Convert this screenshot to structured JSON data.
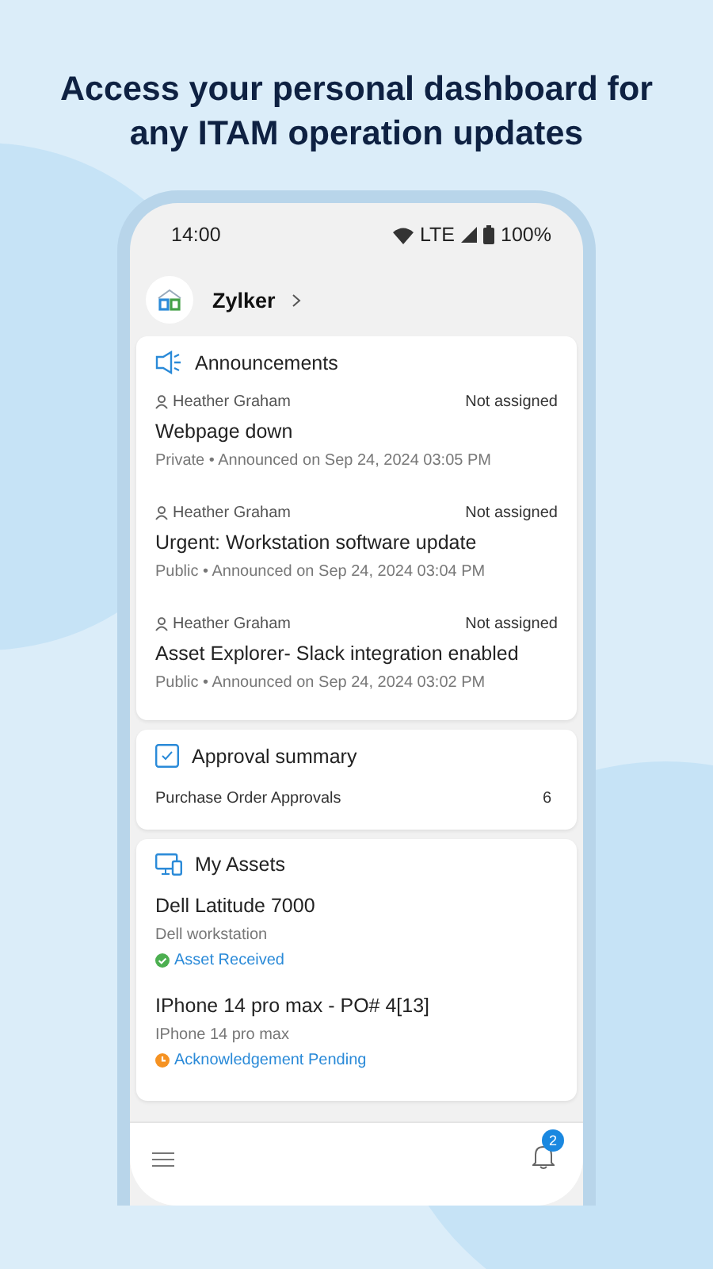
{
  "headline": "Access your personal dashboard for any ITAM operation updates",
  "status_bar": {
    "time": "14:00",
    "network": "LTE",
    "battery": "100%"
  },
  "header": {
    "org": "Zylker"
  },
  "announcements": {
    "title": "Announcements",
    "items": [
      {
        "author": "Heather Graham",
        "assignee": "Not assigned",
        "title": "Webpage down",
        "meta": "Private • Announced on Sep 24, 2024 03:05 PM"
      },
      {
        "author": "Heather Graham",
        "assignee": "Not assigned",
        "title": "Urgent: Workstation software update",
        "meta": "Public • Announced on Sep 24, 2024 03:04 PM"
      },
      {
        "author": "Heather Graham",
        "assignee": "Not assigned",
        "title": "Asset Explorer- Slack integration enabled",
        "meta": "Public • Announced on Sep 24, 2024 03:02 PM"
      }
    ]
  },
  "approval_summary": {
    "title": "Approval summary",
    "rows": [
      {
        "label": "Purchase Order Approvals",
        "count": "6"
      }
    ]
  },
  "my_assets": {
    "title": "My Assets",
    "items": [
      {
        "name": "Dell Latitude 7000",
        "description": "Dell workstation",
        "status": "Asset Received",
        "kind": "done",
        "color": "#4caf50"
      },
      {
        "name": "IPhone 14 pro max - PO# 4[13]",
        "description": "IPhone 14 pro max",
        "status": "Acknowledgement Pending",
        "kind": "pending",
        "color": "#f59222"
      }
    ]
  },
  "bottom_bar": {
    "notification_count": "2"
  }
}
